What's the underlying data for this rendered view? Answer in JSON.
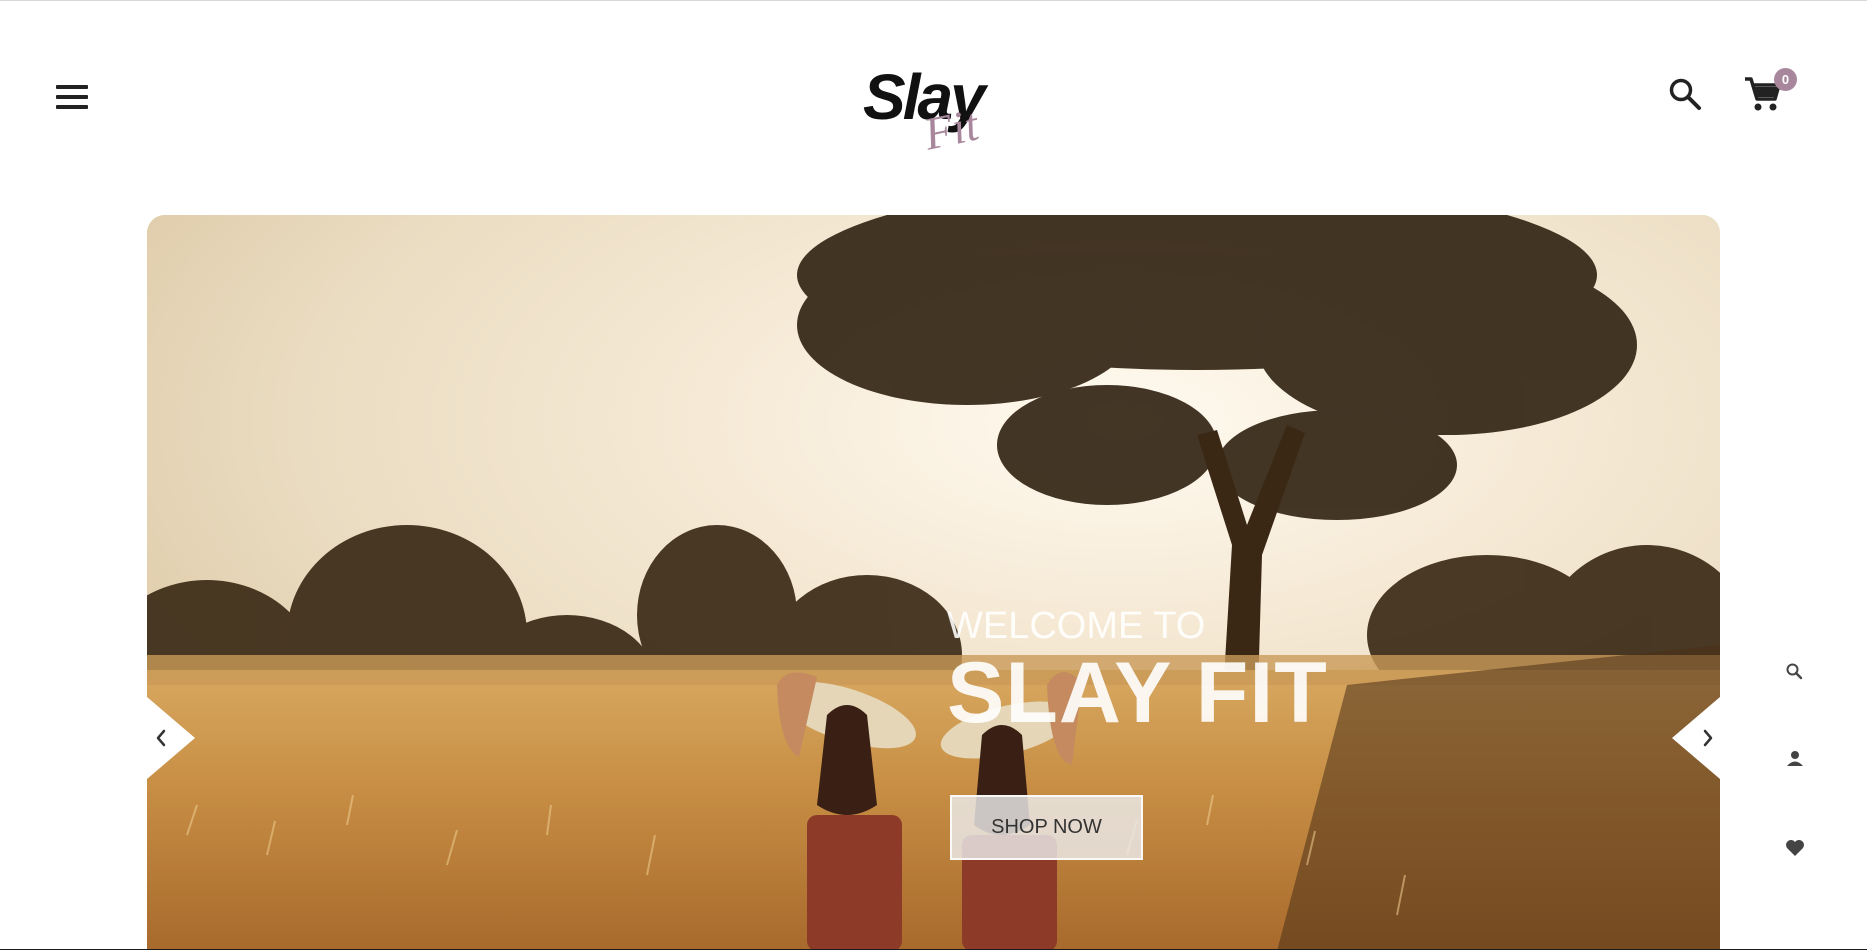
{
  "header": {
    "logo_main": "Slay",
    "logo_script": "Fit",
    "cart_count": "0",
    "icons": [
      "hamburger-menu-icon",
      "search-icon",
      "shopping-cart-icon"
    ]
  },
  "hero": {
    "welcome": "WELCOME TO",
    "brand": "SLAY FIT",
    "cta_label": "SHOP NOW",
    "arrows": [
      "chevron-left-icon",
      "chevron-right-icon"
    ]
  },
  "side_toolbar": {
    "icons": [
      "search-icon",
      "user-icon",
      "heart-icon"
    ]
  },
  "colors": {
    "accent": "#a8879c",
    "text_dark": "#222222",
    "background": "#ffffff"
  }
}
